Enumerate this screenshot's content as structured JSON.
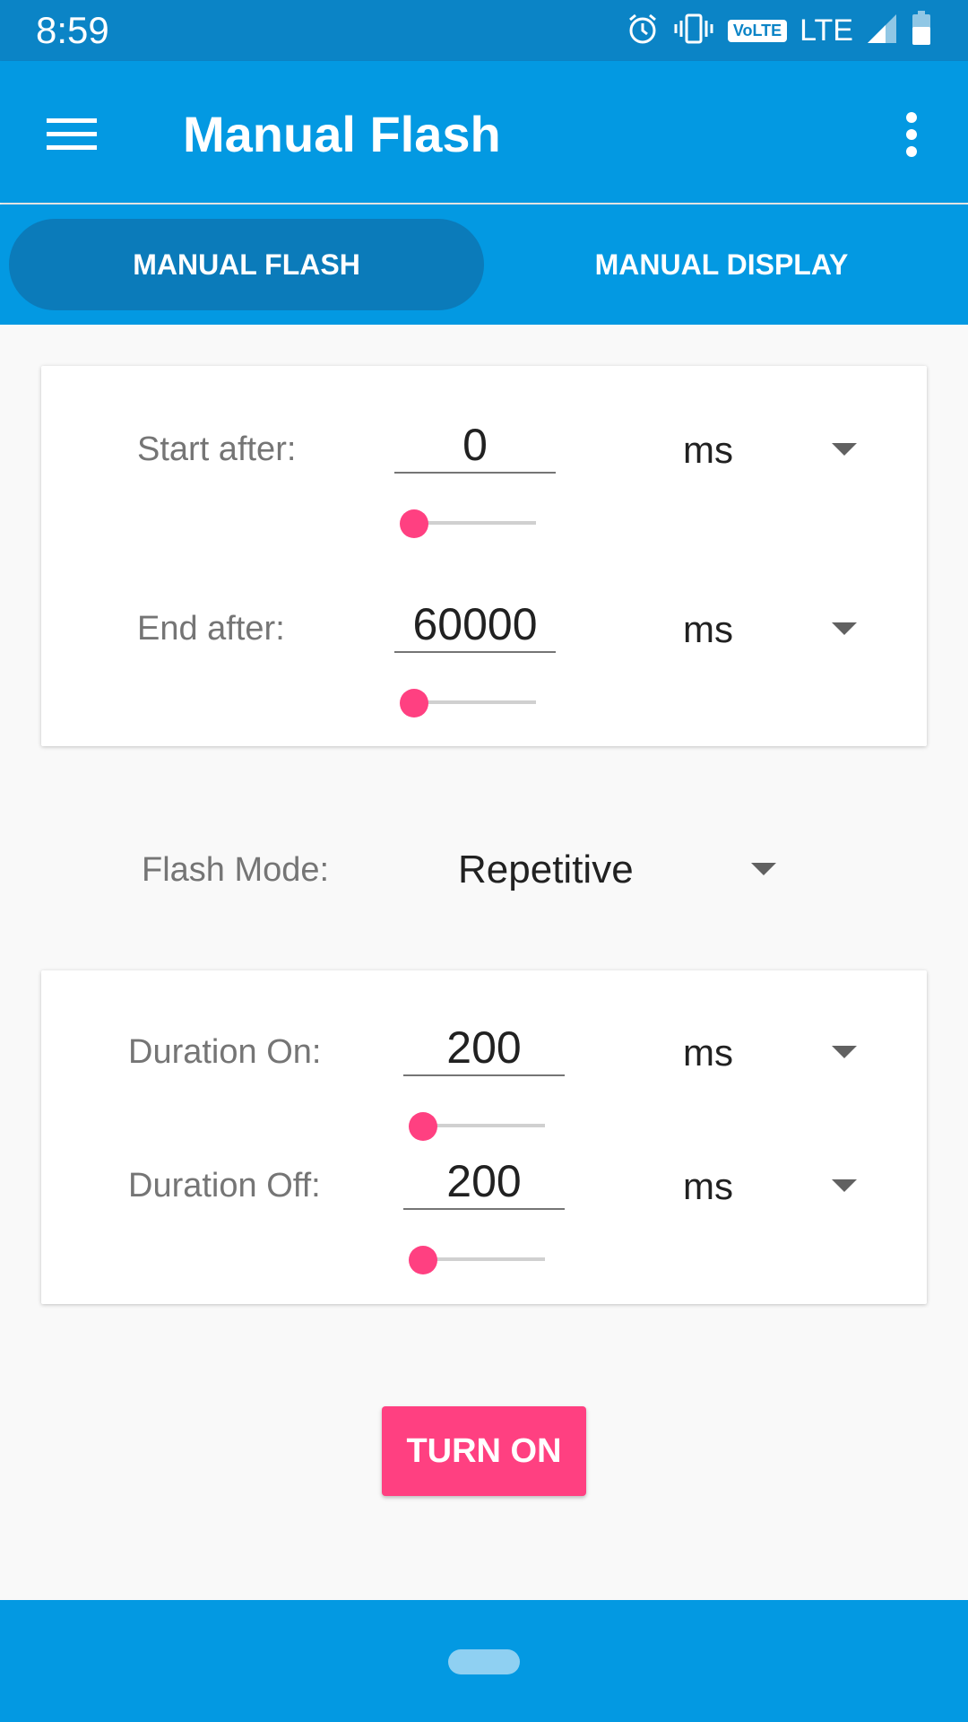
{
  "status_bar": {
    "time": "8:59",
    "icons": [
      "alarm-icon",
      "vibrate-icon",
      "volte-badge",
      "lte-label",
      "signal-icon",
      "battery-icon"
    ],
    "volte": "VoLTE",
    "network": "LTE"
  },
  "app_bar": {
    "title": "Manual Flash",
    "menu_icon": "hamburger-menu-icon",
    "overflow_icon": "more-vert-icon"
  },
  "tabs": [
    {
      "label": "MANUAL FLASH",
      "selected": true
    },
    {
      "label": "MANUAL DISPLAY",
      "selected": false
    }
  ],
  "timing": {
    "start_after": {
      "label": "Start after:",
      "value": "0",
      "unit": "ms",
      "slider_level": 0
    },
    "end_after": {
      "label": "End after:",
      "value": "60000",
      "unit": "ms",
      "slider_level": 0
    }
  },
  "flash_mode": {
    "label": "Flash Mode:",
    "value": "Repetitive"
  },
  "duration": {
    "on": {
      "label": "Duration On:",
      "value": "200",
      "unit": "ms",
      "slider_level": 0
    },
    "off": {
      "label": "Duration Off:",
      "value": "200",
      "unit": "ms",
      "slider_level": 0
    }
  },
  "action": {
    "label": "TURN ON"
  },
  "colors": {
    "primary": "#0399e2",
    "primary_dark": "#0b84c6",
    "tab_selected": "#0b7bba",
    "accent": "#ff4081",
    "background": "#f9f9f9"
  }
}
